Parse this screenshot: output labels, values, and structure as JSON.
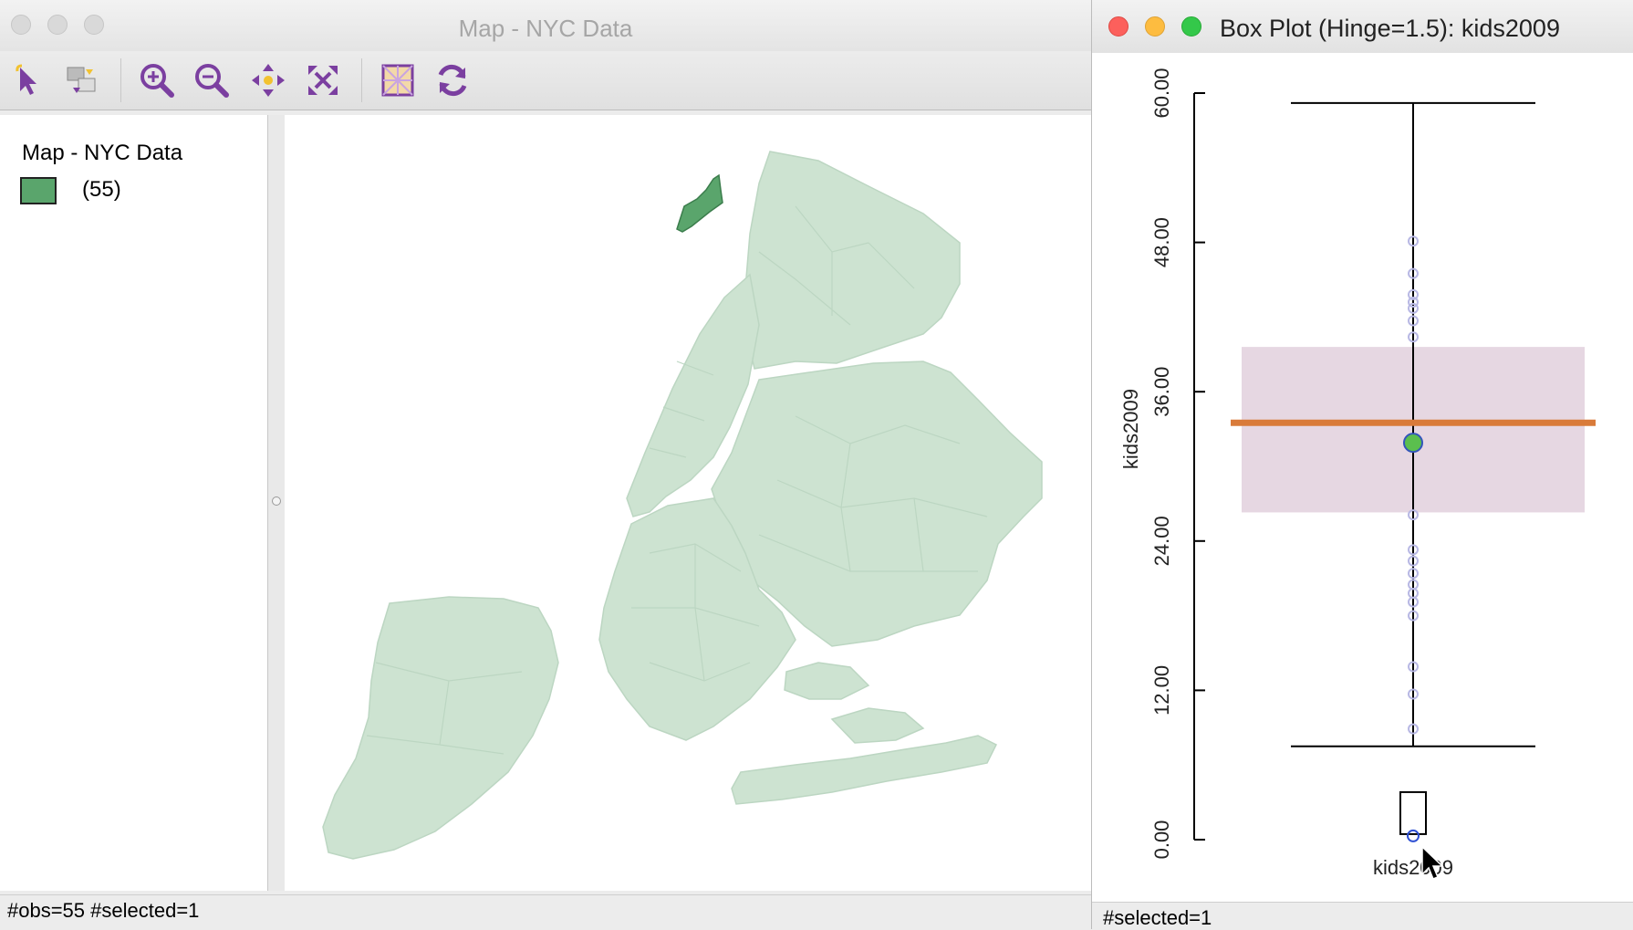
{
  "map_window": {
    "title": "Map - NYC Data",
    "legend": {
      "title": "Map - NYC Data",
      "swatch_color": "#5aa56c",
      "count_label": "(55)"
    },
    "status": "#obs=55 #selected=1",
    "colors": {
      "unselected": "#cde3d1",
      "selected": "#5aa56c"
    },
    "toolbar": [
      {
        "name": "select-icon"
      },
      {
        "name": "select-toggle-icon"
      },
      {
        "name": "zoom-in-icon"
      },
      {
        "name": "zoom-out-icon"
      },
      {
        "name": "pan-icon"
      },
      {
        "name": "fit-extent-icon"
      },
      {
        "name": "basemap-icon"
      },
      {
        "name": "refresh-icon"
      }
    ]
  },
  "box_window": {
    "title": "Box Plot (Hinge=1.5): kids2009",
    "status": "#selected=1",
    "chart_data": {
      "type": "box",
      "variable": "kids2009",
      "ylabel": "kids2009",
      "xlabel": "kids2009",
      "ylim": [
        0,
        60
      ],
      "yticks": [
        "0.00",
        "12.00",
        "24.00",
        "36.00",
        "48.00",
        "60.00"
      ],
      "ytick_values": [
        0,
        12,
        24,
        36,
        48,
        60
      ],
      "whisker_low": 7.5,
      "whisker_high": 59.2,
      "q1": 26.3,
      "q3": 39.6,
      "median": 33.5,
      "mean": 31.9,
      "points": [
        0.3,
        8.9,
        11.7,
        13.9,
        18.0,
        19.1,
        19.8,
        20.5,
        21.4,
        22.4,
        23.3,
        26.1,
        40.4,
        41.7,
        42.7,
        43.2,
        43.8,
        45.5,
        48.1
      ],
      "selected_point": 0.3,
      "colors": {
        "box": "#e6d7e2",
        "median": "#d97b3a",
        "mean": "#5bbf4e",
        "points": "#b8b8e4",
        "selected": "#2d4fd3"
      }
    }
  }
}
